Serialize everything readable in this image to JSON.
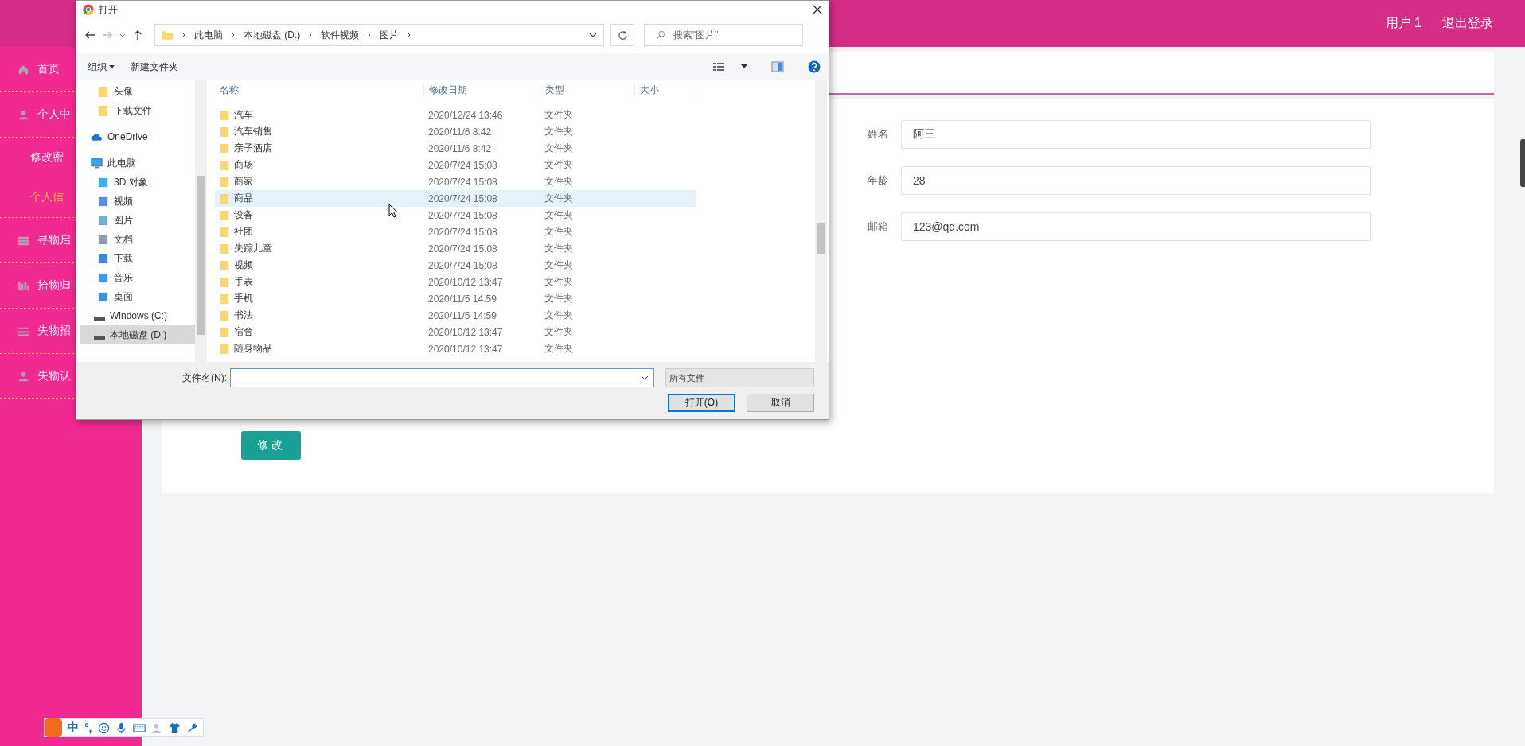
{
  "header": {
    "user": "用户 1",
    "logout": "退出登录"
  },
  "sidebar": {
    "items": [
      {
        "label": "首页",
        "kind": "item",
        "selected": false
      },
      {
        "label": "个人中",
        "kind": "item",
        "selected": false
      },
      {
        "label": "修改密",
        "kind": "sub",
        "selected": false
      },
      {
        "label": "个人信",
        "kind": "sub",
        "selected": true
      },
      {
        "label": "寻物启",
        "kind": "item",
        "selected": false
      },
      {
        "label": "拾物归",
        "kind": "item",
        "selected": false
      },
      {
        "label": "失物招",
        "kind": "item",
        "selected": false
      },
      {
        "label": "失物认",
        "kind": "item",
        "selected": false
      }
    ]
  },
  "form": {
    "fields": [
      {
        "label": "姓名",
        "value": "阿三"
      },
      {
        "label": "年龄",
        "value": "28"
      },
      {
        "label": "邮箱",
        "value": "123@qq.com"
      }
    ],
    "submit": "修改"
  },
  "dialog": {
    "title": "打开",
    "path": [
      "此电脑",
      "本地磁盘 (D:)",
      "软件视频",
      "图片"
    ],
    "search": {
      "placeholder": "搜索\"图片\""
    },
    "toolbar": [
      "组织",
      "新建文件夹"
    ],
    "nav": [
      {
        "label": "头像",
        "kind": "quick",
        "selected": false
      },
      {
        "label": "下载文件",
        "kind": "quick",
        "selected": false
      },
      {
        "label": "OneDrive",
        "kind": "cloud",
        "selected": false
      },
      {
        "label": "此电脑",
        "kind": "computer",
        "selected": false
      },
      {
        "label": "3D 对象",
        "kind": "library",
        "selected": false
      },
      {
        "label": "视频",
        "kind": "library",
        "selected": false
      },
      {
        "label": "图片",
        "kind": "library",
        "selected": false
      },
      {
        "label": "文档",
        "kind": "library",
        "selected": false
      },
      {
        "label": "下载",
        "kind": "library",
        "selected": false
      },
      {
        "label": "音乐",
        "kind": "library",
        "selected": false
      },
      {
        "label": "桌面",
        "kind": "library",
        "selected": false
      },
      {
        "label": "Windows (C:)",
        "kind": "drive",
        "selected": false
      },
      {
        "label": "本地磁盘 (D:)",
        "kind": "drive",
        "selected": true
      }
    ],
    "columns": [
      "名称",
      "修改日期",
      "类型",
      "大小"
    ],
    "rows": [
      {
        "name": "汽车",
        "date": "2020/12/24 13:46",
        "type": "文件夹",
        "selected": false
      },
      {
        "name": "汽车销售",
        "date": "2020/11/6 8:42",
        "type": "文件夹",
        "selected": false
      },
      {
        "name": "亲子酒店",
        "date": "2020/11/6 8:42",
        "type": "文件夹",
        "selected": false
      },
      {
        "name": "商场",
        "date": "2020/7/24 15:08",
        "type": "文件夹",
        "selected": false
      },
      {
        "name": "商家",
        "date": "2020/7/24 15:08",
        "type": "文件夹",
        "selected": false
      },
      {
        "name": "商品",
        "date": "2020/7/24 15:08",
        "type": "文件夹",
        "selected": true
      },
      {
        "name": "设备",
        "date": "2020/7/24 15:08",
        "type": "文件夹",
        "selected": false
      },
      {
        "name": "社团",
        "date": "2020/7/24 15:08",
        "type": "文件夹",
        "selected": false
      },
      {
        "name": "失踪儿童",
        "date": "2020/7/24 15:08",
        "type": "文件夹",
        "selected": false
      },
      {
        "name": "视频",
        "date": "2020/7/24 15:08",
        "type": "文件夹",
        "selected": false
      },
      {
        "name": "手表",
        "date": "2020/10/12 13:47",
        "type": "文件夹",
        "selected": false
      },
      {
        "name": "手机",
        "date": "2020/11/5 14:59",
        "type": "文件夹",
        "selected": false
      },
      {
        "name": "书法",
        "date": "2020/11/5 14:59",
        "type": "文件夹",
        "selected": false
      },
      {
        "name": "宿舍",
        "date": "2020/10/12 13:47",
        "type": "文件夹",
        "selected": false
      },
      {
        "name": "随身物品",
        "date": "2020/10/12 13:47",
        "type": "文件夹",
        "selected": false
      }
    ],
    "filename": {
      "label": "文件名(N):"
    },
    "filter": "所有文件",
    "buttons": [
      "打开(O)",
      "取消"
    ]
  },
  "ime": {
    "mode": "中",
    "punct": "°,"
  }
}
